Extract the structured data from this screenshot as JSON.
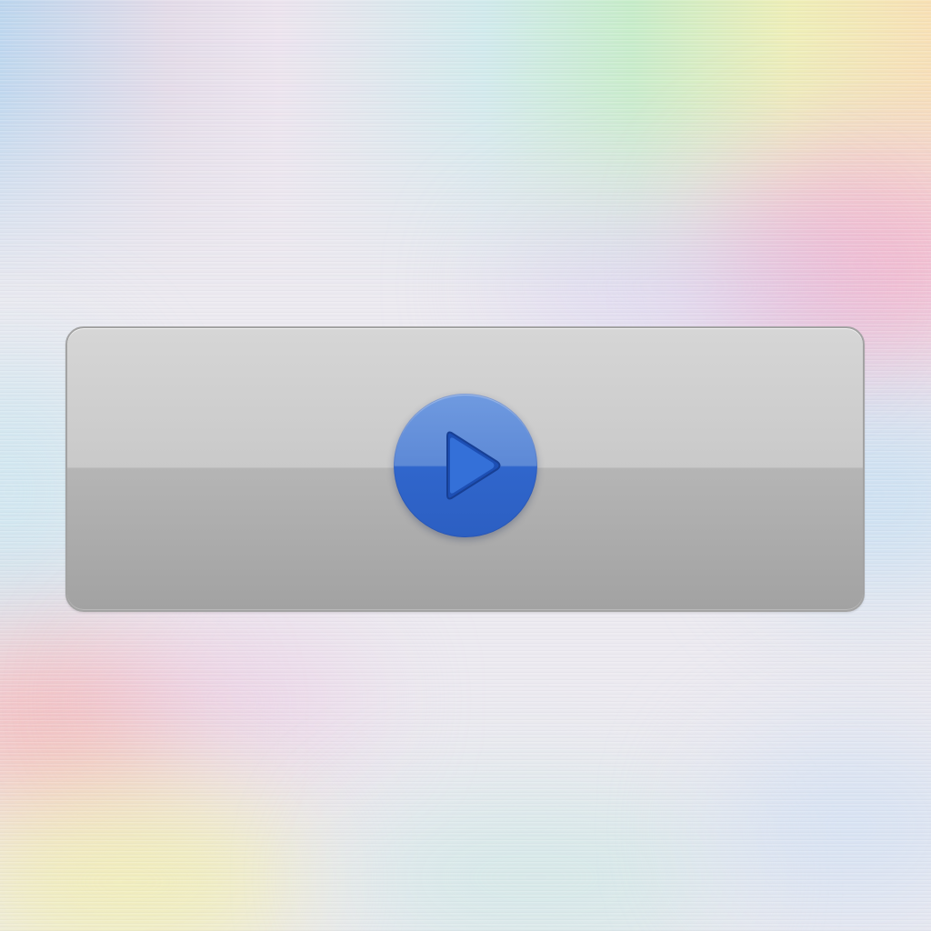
{
  "player": {
    "play_button": {
      "icon": "play-icon",
      "accent_color": "#3366cc"
    }
  },
  "colors": {
    "panel": "#c4c4c4",
    "panel_border": "#a3a3a3",
    "button_blue": "#3066cc"
  }
}
